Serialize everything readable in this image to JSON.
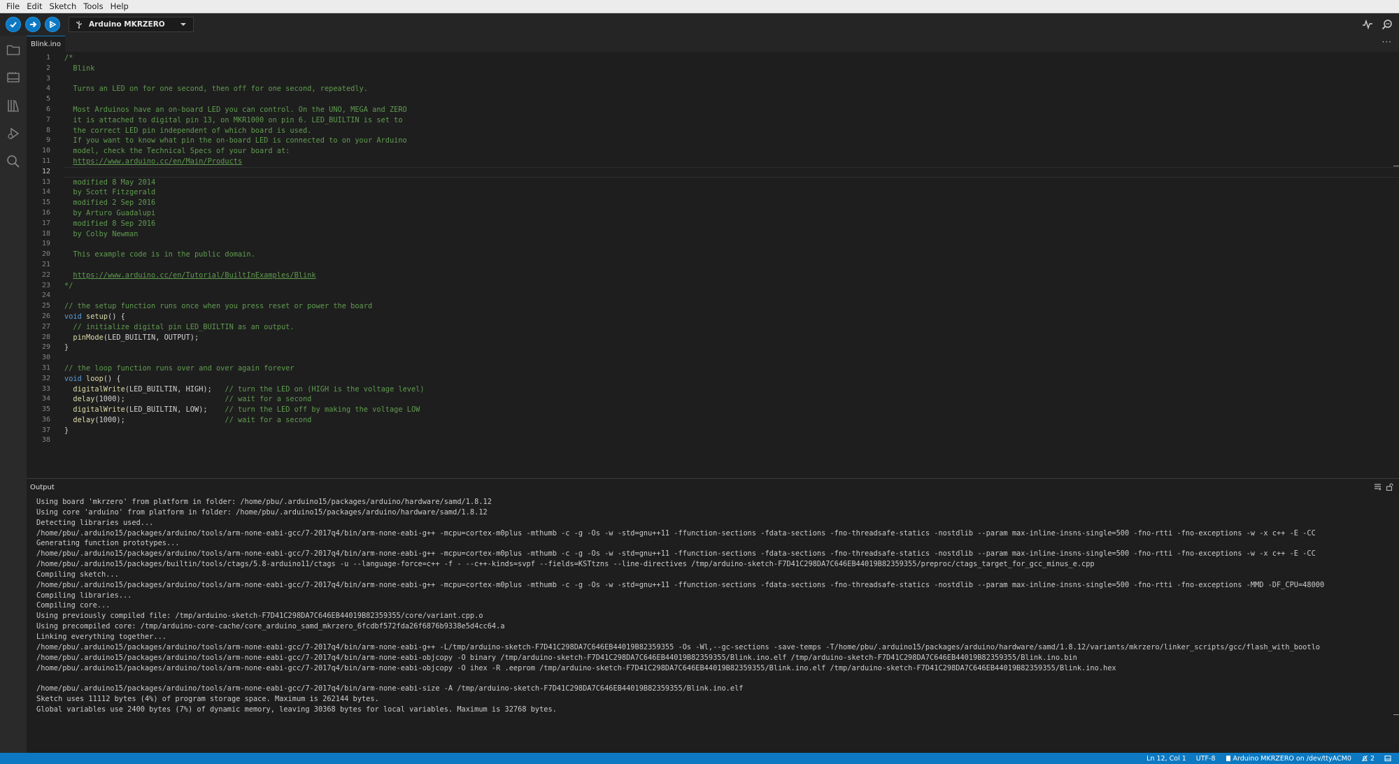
{
  "menu": [
    "File",
    "Edit",
    "Sketch",
    "Tools",
    "Help"
  ],
  "toolbar": {
    "board": "Arduino MKRZERO"
  },
  "tabs": [
    {
      "label": "Blink.ino",
      "active": true
    }
  ],
  "editor": {
    "current_line": 12,
    "lines": [
      {
        "n": 1,
        "html": "<span class=\"cm\">/*</span>"
      },
      {
        "n": 2,
        "html": "<span class=\"cm\">  Blink</span>"
      },
      {
        "n": 3,
        "html": ""
      },
      {
        "n": 4,
        "html": "<span class=\"cm\">  Turns an LED on for one second, then off for one second, repeatedly.</span>"
      },
      {
        "n": 5,
        "html": ""
      },
      {
        "n": 6,
        "html": "<span class=\"cm\">  Most Arduinos have an on-board LED you can control. On the UNO, MEGA and ZERO</span>"
      },
      {
        "n": 7,
        "html": "<span class=\"cm\">  it is attached to digital pin 13, on MKR1000 on pin 6. LED_BUILTIN is set to</span>"
      },
      {
        "n": 8,
        "html": "<span class=\"cm\">  the correct LED pin independent of which board is used.</span>"
      },
      {
        "n": 9,
        "html": "<span class=\"cm\">  If you want to know what pin the on-board LED is connected to on your Arduino</span>"
      },
      {
        "n": 10,
        "html": "<span class=\"cm\">  model, check the Technical Specs of your board at:</span>"
      },
      {
        "n": 11,
        "html": "<span class=\"cm\">  <a>https://www.arduino.cc/en/Main/Products</a></span>"
      },
      {
        "n": 12,
        "html": ""
      },
      {
        "n": 13,
        "html": "<span class=\"cm\">  modified 8 May 2014</span>"
      },
      {
        "n": 14,
        "html": "<span class=\"cm\">  by Scott Fitzgerald</span>"
      },
      {
        "n": 15,
        "html": "<span class=\"cm\">  modified 2 Sep 2016</span>"
      },
      {
        "n": 16,
        "html": "<span class=\"cm\">  by Arturo Guadalupi</span>"
      },
      {
        "n": 17,
        "html": "<span class=\"cm\">  modified 8 Sep 2016</span>"
      },
      {
        "n": 18,
        "html": "<span class=\"cm\">  by Colby Newman</span>"
      },
      {
        "n": 19,
        "html": ""
      },
      {
        "n": 20,
        "html": "<span class=\"cm\">  This example code is in the public domain.</span>"
      },
      {
        "n": 21,
        "html": ""
      },
      {
        "n": 22,
        "html": "<span class=\"cm\">  <a>https://www.arduino.cc/en/Tutorial/BuiltInExamples/Blink</a></span>"
      },
      {
        "n": 23,
        "html": "<span class=\"cm\">*/</span>"
      },
      {
        "n": 24,
        "html": ""
      },
      {
        "n": 25,
        "html": "<span class=\"cm\">// the setup function runs once when you press reset or power the board</span>"
      },
      {
        "n": 26,
        "html": "<span class=\"kw\">void</span> <span class=\"fn\">setup</span>() {"
      },
      {
        "n": 27,
        "html": "  <span class=\"cm\">// initialize digital pin LED_BUILTIN as an output.</span>"
      },
      {
        "n": 28,
        "html": "  <span class=\"fn\">pinMode</span>(LED_BUILTIN, OUTPUT);"
      },
      {
        "n": 29,
        "html": "}"
      },
      {
        "n": 30,
        "html": ""
      },
      {
        "n": 31,
        "html": "<span class=\"cm\">// the loop function runs over and over again forever</span>"
      },
      {
        "n": 32,
        "html": "<span class=\"kw\">void</span> <span class=\"fn\">loop</span>() {"
      },
      {
        "n": 33,
        "html": "  <span class=\"fn\">digitalWrite</span>(LED_BUILTIN, HIGH);   <span class=\"cm\">// turn the LED on (HIGH is the voltage level)</span>"
      },
      {
        "n": 34,
        "html": "  <span class=\"fn\">delay</span>(1000);                       <span class=\"cm\">// wait for a second</span>"
      },
      {
        "n": 35,
        "html": "  <span class=\"fn\">digitalWrite</span>(LED_BUILTIN, LOW);    <span class=\"cm\">// turn the LED off by making the voltage LOW</span>"
      },
      {
        "n": 36,
        "html": "  <span class=\"fn\">delay</span>(1000);                       <span class=\"cm\">// wait for a second</span>"
      },
      {
        "n": 37,
        "html": "}"
      },
      {
        "n": 38,
        "html": ""
      }
    ]
  },
  "output": {
    "title": "Output",
    "lines": [
      "Using board 'mkrzero' from platform in folder: /home/pbu/.arduino15/packages/arduino/hardware/samd/1.8.12",
      "Using core 'arduino' from platform in folder: /home/pbu/.arduino15/packages/arduino/hardware/samd/1.8.12",
      "Detecting libraries used...",
      "/home/pbu/.arduino15/packages/arduino/tools/arm-none-eabi-gcc/7-2017q4/bin/arm-none-eabi-g++ -mcpu=cortex-m0plus -mthumb -c -g -Os -w -std=gnu++11 -ffunction-sections -fdata-sections -fno-threadsafe-statics -nostdlib --param max-inline-insns-single=500 -fno-rtti -fno-exceptions -w -x c++ -E -CC",
      "Generating function prototypes...",
      "/home/pbu/.arduino15/packages/arduino/tools/arm-none-eabi-gcc/7-2017q4/bin/arm-none-eabi-g++ -mcpu=cortex-m0plus -mthumb -c -g -Os -w -std=gnu++11 -ffunction-sections -fdata-sections -fno-threadsafe-statics -nostdlib --param max-inline-insns-single=500 -fno-rtti -fno-exceptions -w -x c++ -E -CC",
      "/home/pbu/.arduino15/packages/builtin/tools/ctags/5.8-arduino11/ctags -u --language-force=c++ -f - --c++-kinds=svpf --fields=KSTtzns --line-directives /tmp/arduino-sketch-F7D41C298DA7C646EB44019B82359355/preproc/ctags_target_for_gcc_minus_e.cpp",
      "Compiling sketch...",
      "/home/pbu/.arduino15/packages/arduino/tools/arm-none-eabi-gcc/7-2017q4/bin/arm-none-eabi-g++ -mcpu=cortex-m0plus -mthumb -c -g -Os -w -std=gnu++11 -ffunction-sections -fdata-sections -fno-threadsafe-statics -nostdlib --param max-inline-insns-single=500 -fno-rtti -fno-exceptions -MMD -DF_CPU=48000",
      "Compiling libraries...",
      "Compiling core...",
      "Using previously compiled file: /tmp/arduino-sketch-F7D41C298DA7C646EB44019B82359355/core/variant.cpp.o",
      "Using precompiled core: /tmp/arduino-core-cache/core_arduino_samd_mkrzero_6fcdbf572fda26f6876b9338e5d4cc64.a",
      "Linking everything together...",
      "/home/pbu/.arduino15/packages/arduino/tools/arm-none-eabi-gcc/7-2017q4/bin/arm-none-eabi-g++ -L/tmp/arduino-sketch-F7D41C298DA7C646EB44019B82359355 -Os -Wl,--gc-sections -save-temps -T/home/pbu/.arduino15/packages/arduino/hardware/samd/1.8.12/variants/mkrzero/linker_scripts/gcc/flash_with_bootlo",
      "/home/pbu/.arduino15/packages/arduino/tools/arm-none-eabi-gcc/7-2017q4/bin/arm-none-eabi-objcopy -O binary /tmp/arduino-sketch-F7D41C298DA7C646EB44019B82359355/Blink.ino.elf /tmp/arduino-sketch-F7D41C298DA7C646EB44019B82359355/Blink.ino.bin",
      "/home/pbu/.arduino15/packages/arduino/tools/arm-none-eabi-gcc/7-2017q4/bin/arm-none-eabi-objcopy -O ihex -R .eeprom /tmp/arduino-sketch-F7D41C298DA7C646EB44019B82359355/Blink.ino.elf /tmp/arduino-sketch-F7D41C298DA7C646EB44019B82359355/Blink.ino.hex",
      "",
      "/home/pbu/.arduino15/packages/arduino/tools/arm-none-eabi-gcc/7-2017q4/bin/arm-none-eabi-size -A /tmp/arduino-sketch-F7D41C298DA7C646EB44019B82359355/Blink.ino.elf",
      "Sketch uses 11112 bytes (4%) of program storage space. Maximum is 262144 bytes.",
      "Global variables use 2400 bytes (7%) of dynamic memory, leaving 30368 bytes for local variables. Maximum is 32768 bytes."
    ]
  },
  "status": {
    "position": "Ln 12, Col 1",
    "encoding": "UTF-8",
    "board_port": "Arduino MKRZERO on /dev/ttyACM0",
    "notifications": "2"
  },
  "colors": {
    "accent": "#0c79c2",
    "comment": "#5f9b4f",
    "keyword": "#569cd6",
    "function": "#dcdcaa"
  }
}
